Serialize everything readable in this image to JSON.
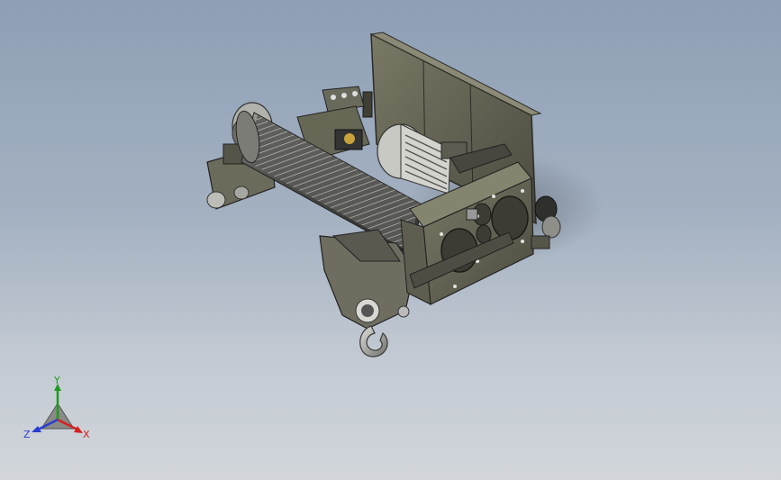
{
  "triad": {
    "x_label": "X",
    "y_label": "Y",
    "z_label": "Z"
  },
  "colors": {
    "background_top": "#8e9fb6",
    "background_bottom": "#d2d6db",
    "body": "#5f5f52",
    "axis_x": "#d42020",
    "axis_y": "#1f9a1f",
    "axis_z": "#2a3fd1"
  },
  "icons": [
    "hoist-model",
    "view-triad-icon"
  ]
}
